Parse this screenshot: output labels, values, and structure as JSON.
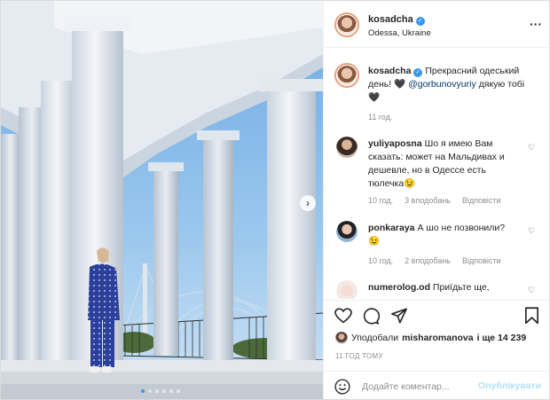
{
  "post": {
    "username": "kosadcha",
    "location": "Odessa, Ukraine",
    "more_icon": "ellipsis-icon",
    "caption_username": "kosadcha",
    "caption_text_1": "Прекрасний одеський",
    "caption_text_2": "день! 🖤",
    "caption_mention": "@gorbunovyuriy",
    "caption_text_3": "дякую тобі",
    "caption_text_4": "🖤",
    "caption_time": "11 год."
  },
  "comments": [
    {
      "username": "yuliyaposna",
      "line1": "Шо я имею Вам",
      "line2": "сказать: может на Мальдивах и",
      "line3": "дешевле, но в Одессе есть",
      "line4": "тюлечка😉",
      "time": "10 год.",
      "likes": "3 вподобань",
      "reply": "Відповісти"
    },
    {
      "username": "ponkaraya",
      "line1": "А шо не позвонили?",
      "line2": "😉",
      "time": "10 год.",
      "likes": "2 вподобань",
      "reply": "Відповісти"
    },
    {
      "username": "numerolog.od",
      "line1": "Приїдьте ще,"
    }
  ],
  "likes": {
    "prefix": "Уподобали",
    "user": "misharomanova",
    "suffix": "і ще 14 239"
  },
  "time_ago": "11 ГОД ТОМУ",
  "add_comment": {
    "placeholder": "Додайте коментар...",
    "post_label": "Опублікувати"
  },
  "carousel": {
    "count": 6,
    "active": 1
  },
  "colors": {
    "accent": "#3897f0",
    "post_disabled": "#b2dffc",
    "sky": "#7fb3e3"
  }
}
